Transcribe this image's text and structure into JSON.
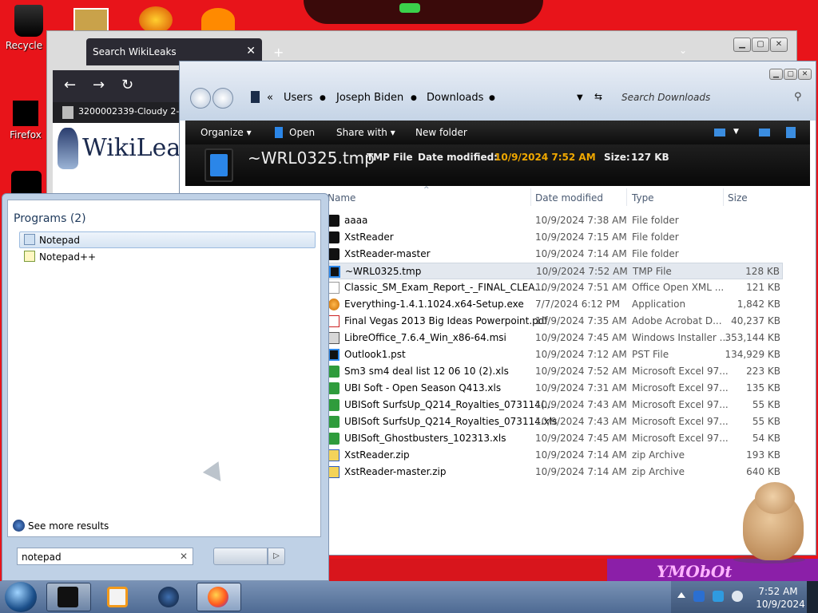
{
  "desktop": {
    "icons": [
      {
        "label": "Recycle B"
      },
      {
        "label": "Firefox"
      }
    ],
    "wallpaper_text": "YMObOt"
  },
  "browser": {
    "tab_title": "Search WikiLeaks",
    "bookmark": "3200002339-Cloudy 2-...",
    "logo_text": "WikiLeaks"
  },
  "explorer": {
    "breadcrumb": [
      "«",
      "Users",
      "Joseph Biden",
      "Downloads"
    ],
    "search_placeholder": "Search Downloads",
    "toolbar": {
      "organize": "Organize",
      "open": "Open",
      "share_with": "Share with",
      "new_folder": "New folder"
    },
    "details": {
      "name": "~WRL0325.tmp",
      "type": "TMP File",
      "modified_label": "Date modified:",
      "modified": "10/9/2024 7:52 AM",
      "size_label": "Size:",
      "size": "127 KB"
    },
    "columns": [
      "Name",
      "Date modified",
      "Type",
      "Size"
    ],
    "files": [
      {
        "name": "aaaa",
        "date": "10/9/2024 7:38 AM",
        "type": "File folder",
        "size": "",
        "icon": "folder-black"
      },
      {
        "name": "XstReader",
        "date": "10/9/2024 7:15 AM",
        "type": "File folder",
        "size": "",
        "icon": "folder-black"
      },
      {
        "name": "XstReader-master",
        "date": "10/9/2024 7:14 AM",
        "type": "File folder",
        "size": "",
        "icon": "folder-black"
      },
      {
        "name": "~WRL0325.tmp",
        "date": "10/9/2024 7:52 AM",
        "type": "TMP File",
        "size": "128 KB",
        "icon": "tmp-file"
      },
      {
        "name": "Classic_SM_Exam_Report_-_FINAL_CLEA...",
        "date": "10/9/2024 7:51 AM",
        "type": "Office Open XML ...",
        "size": "121 KB",
        "icon": "document"
      },
      {
        "name": "Everything-1.4.1.1024.x64-Setup.exe",
        "date": "7/7/2024 6:12 PM",
        "type": "Application",
        "size": "1,842 KB",
        "icon": "search-app"
      },
      {
        "name": "Final Vegas 2013 Big Ideas Powerpoint.pdf",
        "date": "10/9/2024 7:35 AM",
        "type": "Adobe Acrobat D...",
        "size": "40,237 KB",
        "icon": "pdf"
      },
      {
        "name": "LibreOffice_7.6.4_Win_x86-64.msi",
        "date": "10/9/2024 7:45 AM",
        "type": "Windows Installer ...",
        "size": "353,144 KB",
        "icon": "installer"
      },
      {
        "name": "Outlook1.pst",
        "date": "10/9/2024 7:12 AM",
        "type": "PST File",
        "size": "134,929 KB",
        "icon": "tmp-file"
      },
      {
        "name": "Sm3 sm4 deal list 12 06 10 (2).xls",
        "date": "10/9/2024 7:52 AM",
        "type": "Microsoft Excel 97...",
        "size": "223 KB",
        "icon": "excel"
      },
      {
        "name": "UBI Soft - Open Season Q413.xls",
        "date": "10/9/2024 7:31 AM",
        "type": "Microsoft Excel 97...",
        "size": "135 KB",
        "icon": "excel"
      },
      {
        "name": "UBISoft SurfsUp_Q214_Royalties_073114(...",
        "date": "10/9/2024 7:43 AM",
        "type": "Microsoft Excel 97...",
        "size": "55 KB",
        "icon": "excel"
      },
      {
        "name": "UBISoft SurfsUp_Q214_Royalties_073114.xls",
        "date": "10/9/2024 7:43 AM",
        "type": "Microsoft Excel 97...",
        "size": "55 KB",
        "icon": "excel"
      },
      {
        "name": "UBISoft_Ghostbusters_102313.xls",
        "date": "10/9/2024 7:45 AM",
        "type": "Microsoft Excel 97...",
        "size": "54 KB",
        "icon": "excel"
      },
      {
        "name": "XstReader.zip",
        "date": "10/9/2024 7:14 AM",
        "type": "zip Archive",
        "size": "193 KB",
        "icon": "zip"
      },
      {
        "name": "XstReader-master.zip",
        "date": "10/9/2024 7:14 AM",
        "type": "zip Archive",
        "size": "640 KB",
        "icon": "zip"
      }
    ],
    "selected_index": 3
  },
  "start_menu": {
    "section_title": "Programs (2)",
    "programs": [
      "Notepad",
      "Notepad++"
    ],
    "see_more": "See more results",
    "search_value": "notepad"
  },
  "taskbar": {
    "time": "7:52 AM",
    "date": "10/9/2024"
  },
  "colors": {
    "wallpaper": "#e8141a",
    "detail_accent": "#f0a800",
    "taskbar": "#5e779c"
  }
}
